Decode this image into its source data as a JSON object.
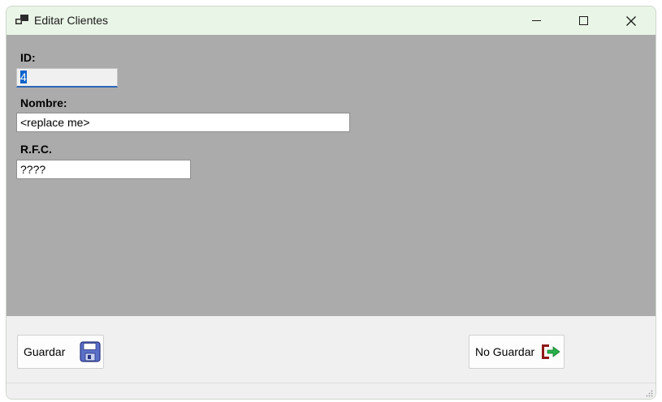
{
  "window": {
    "title": "Editar Clientes",
    "app_icon": "app-window-icon",
    "controls": {
      "minimize": "minimize-icon",
      "maximize": "maximize-icon",
      "close": "close-icon"
    }
  },
  "form": {
    "id_label": "ID:",
    "id_value": "4",
    "nombre_label": "Nombre:",
    "nombre_value": "<replace me>",
    "rfc_label": "R.F.C.",
    "rfc_value": "????"
  },
  "buttons": {
    "guardar_label": "Guardar",
    "guardar_icon": "floppy-disk-icon",
    "no_guardar_label": "No Guardar",
    "no_guardar_icon": "exit-door-icon"
  },
  "colors": {
    "titlebar": "#e9f5e6",
    "client_area": "#ababab",
    "footer": "#f0f0f0",
    "selection": "#0a63c9"
  }
}
